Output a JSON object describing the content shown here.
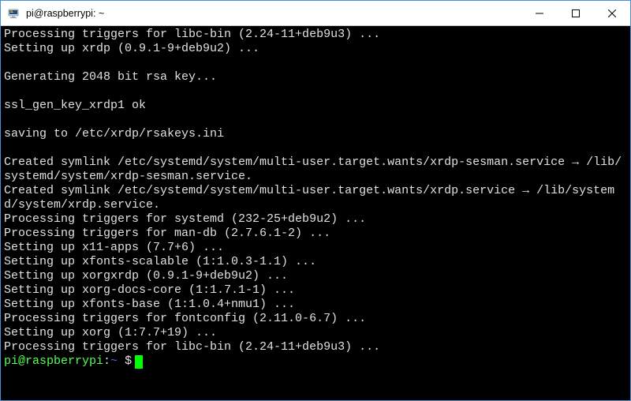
{
  "window": {
    "title": "pi@raspberrypi: ~"
  },
  "terminal": {
    "output": "Processing triggers for libc-bin (2.24-11+deb9u3) ...\nSetting up xrdp (0.9.1-9+deb9u2) ...\n\nGenerating 2048 bit rsa key...\n\nssl_gen_key_xrdp1 ok\n\nsaving to /etc/xrdp/rsakeys.ini\n\nCreated symlink /etc/systemd/system/multi-user.target.wants/xrdp-sesman.service → /lib/systemd/system/xrdp-sesman.service.\nCreated symlink /etc/systemd/system/multi-user.target.wants/xrdp.service → /lib/systemd/system/xrdp.service.\nProcessing triggers for systemd (232-25+deb9u2) ...\nProcessing triggers for man-db (2.7.6.1-2) ...\nSetting up x11-apps (7.7+6) ...\nSetting up xfonts-scalable (1:1.0.3-1.1) ...\nSetting up xorgxrdp (0.9.1-9+deb9u2) ...\nSetting up xorg-docs-core (1:1.7.1-1) ...\nSetting up xfonts-base (1:1.0.4+nmu1) ...\nProcessing triggers for fontconfig (2.11.0-6.7) ...\nSetting up xorg (1:7.7+19) ...\nProcessing triggers for libc-bin (2.24-11+deb9u3) ...",
    "prompt_user": "pi@raspberrypi",
    "prompt_colon": ":",
    "prompt_path": "~ ",
    "prompt_dollar": "$"
  }
}
